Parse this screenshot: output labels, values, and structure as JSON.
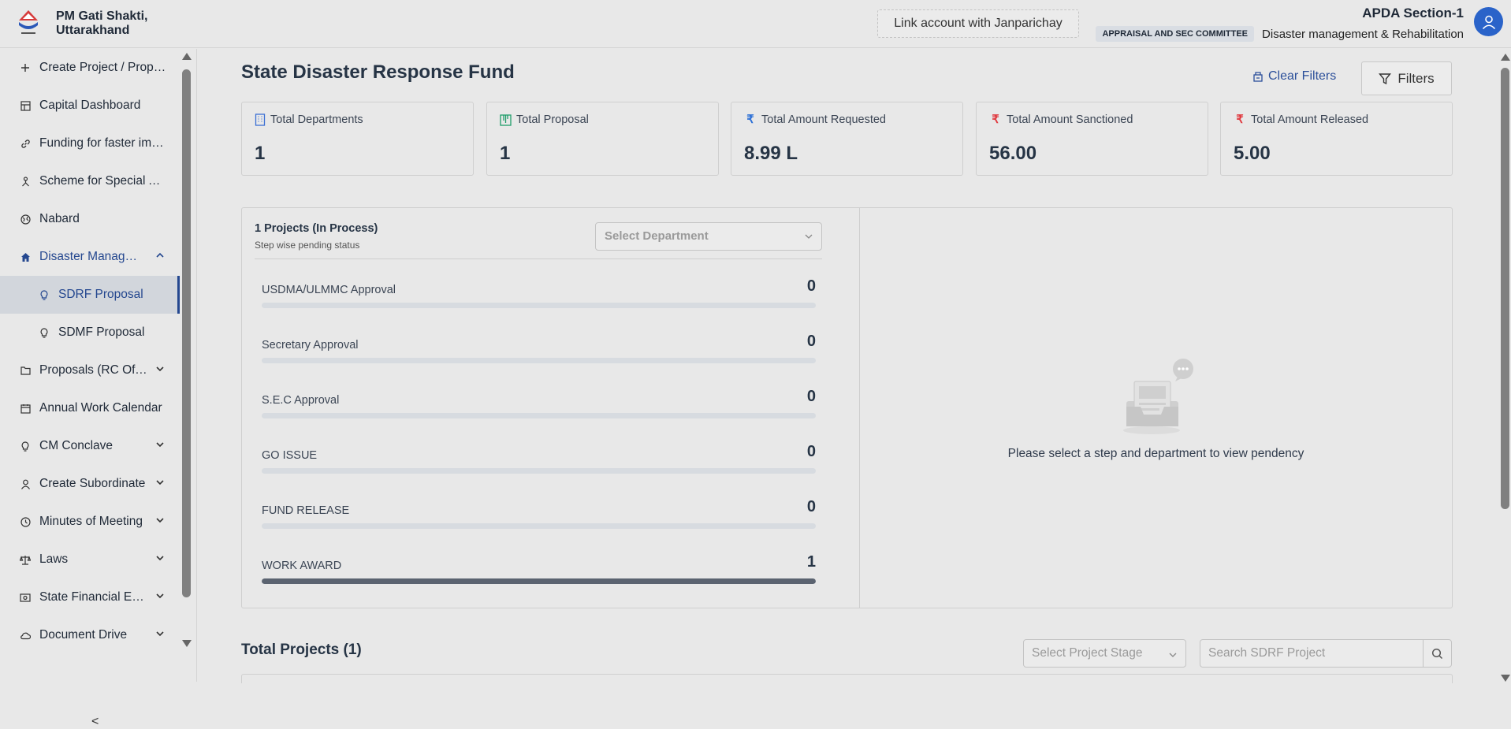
{
  "header": {
    "brand_line1": "PM Gati Shakti,",
    "brand_line2": "Uttarakhand",
    "link_account": "Link account with Janparichay",
    "user_name": "APDA Section-1",
    "role_badge": "APPRAISAL AND SEC COMMITTEE",
    "department": "Disaster management & Rehabilitation"
  },
  "sidebar": {
    "items": [
      {
        "label": "Create Project / Proposal",
        "icon": "plus-icon"
      },
      {
        "label": "Capital Dashboard",
        "icon": "calculator-icon"
      },
      {
        "label": "Funding for faster implementation",
        "icon": "link-icon"
      },
      {
        "label": "Scheme for Special Assistance",
        "icon": "sitemap-icon"
      },
      {
        "label": "Nabard",
        "icon": "globe-icon"
      },
      {
        "label": "Disaster Management",
        "icon": "home-icon"
      },
      {
        "label": "SDRF Proposal",
        "icon": "bulb-icon"
      },
      {
        "label": "SDMF Proposal",
        "icon": "bulb-icon"
      },
      {
        "label": "Proposals (RC Office)",
        "icon": "folder-icon"
      },
      {
        "label": "Annual Work Calendar",
        "icon": "calendar-icon"
      },
      {
        "label": "CM Conclave",
        "icon": "bulb-icon"
      },
      {
        "label": "Create Subordinate",
        "icon": "user-icon"
      },
      {
        "label": "Minutes of Meeting",
        "icon": "clock-icon"
      },
      {
        "label": "Laws",
        "icon": "scale-icon"
      },
      {
        "label": "State Financial Express",
        "icon": "money-icon"
      },
      {
        "label": "Document Drive",
        "icon": "cloud-icon"
      }
    ],
    "collapse": "<"
  },
  "main": {
    "title": "State Disaster Response Fund",
    "clear_filters": "Clear Filters",
    "filters": "Filters",
    "cards": [
      {
        "label": "Total Departments",
        "value": "1",
        "icon": "building-icon",
        "color": "#3b6fd4"
      },
      {
        "label": "Total Proposal",
        "value": "1",
        "icon": "board-icon",
        "color": "#1f9d6a"
      },
      {
        "label": "Total Amount Requested",
        "value": "8.99 L",
        "icon": "rupee-icon",
        "color": "#2b6fd6"
      },
      {
        "label": "Total Amount Sanctioned",
        "value": "56.00",
        "icon": "rupee-icon",
        "color": "#e0383e"
      },
      {
        "label": "Total Amount Released",
        "value": "5.00",
        "icon": "rupee-icon",
        "color": "#e0383e"
      }
    ],
    "pending": {
      "title": "1 Projects (In Process)",
      "subtitle": "Step wise pending status",
      "dept_placeholder": "Select Department",
      "steps": [
        {
          "label": "USDMA/ULMMC Approval",
          "value": "0",
          "fill": 0
        },
        {
          "label": "Secretary Approval",
          "value": "0",
          "fill": 0
        },
        {
          "label": "S.E.C Approval",
          "value": "0",
          "fill": 0
        },
        {
          "label": "GO ISSUE",
          "value": "0",
          "fill": 0
        },
        {
          "label": "FUND RELEASE",
          "value": "0",
          "fill": 0
        },
        {
          "label": "WORK AWARD",
          "value": "1",
          "fill": 1
        }
      ],
      "empty_message": "Please select a step and department to view pendency"
    },
    "total_projects": "Total Projects (1)",
    "stage_placeholder": "Select Project Stage",
    "search_placeholder": "Search SDRF Project"
  }
}
